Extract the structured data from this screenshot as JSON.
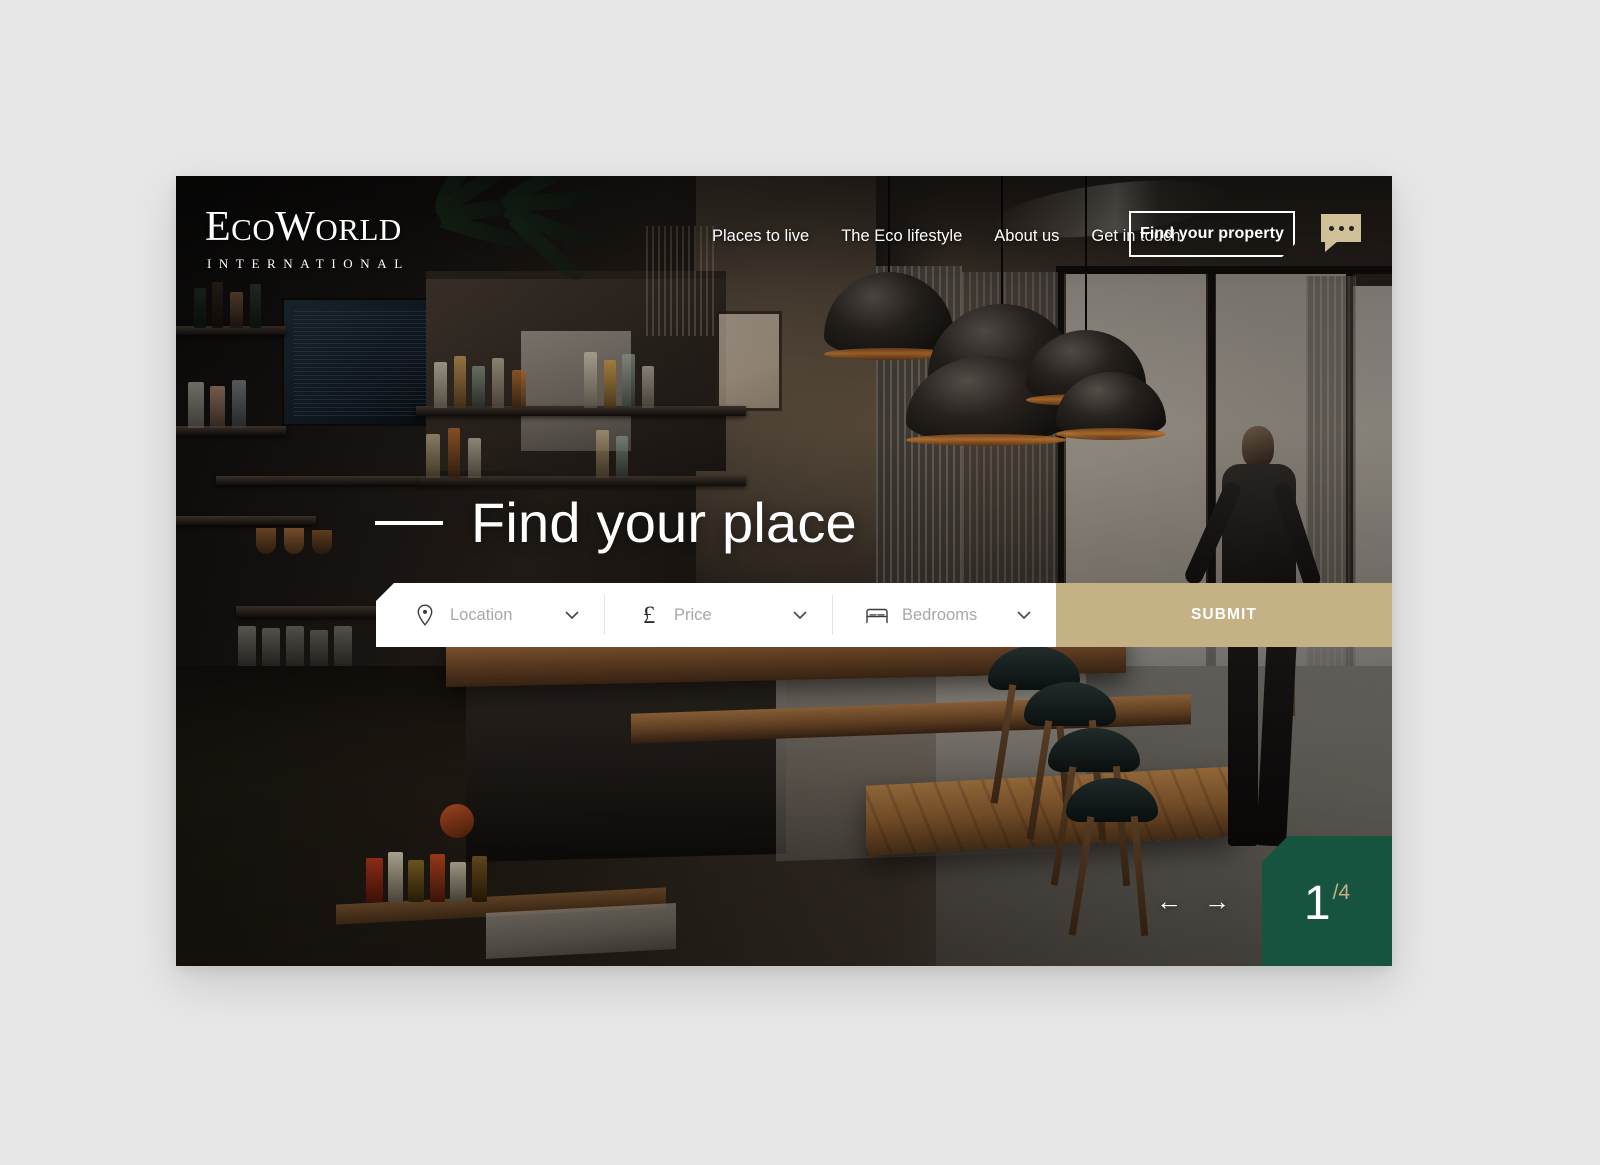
{
  "brand": {
    "logo_part1": "E",
    "logo_part2": "CO",
    "logo_part3": "W",
    "logo_part4": "ORLD",
    "logo_sub": "INTERNATIONAL"
  },
  "nav": {
    "links": [
      {
        "label": "Places to live",
        "name": "nav-places-to-live"
      },
      {
        "label": "The Eco lifestyle",
        "name": "nav-the-eco-lifestyle"
      },
      {
        "label": "About us",
        "name": "nav-about-us"
      },
      {
        "label": "Get in touch",
        "name": "nav-get-in-touch"
      }
    ],
    "cta_label": "Find your property",
    "chat_icon": "chat-bubble-icon"
  },
  "hero": {
    "headline": "Find your place"
  },
  "search": {
    "location": {
      "placeholder": "Location",
      "value": "",
      "icon": "location-pin-icon"
    },
    "price": {
      "placeholder": "Price",
      "value": "",
      "icon": "pound-sterling-icon",
      "symbol": "£"
    },
    "bedrooms": {
      "placeholder": "Bedrooms",
      "value": "",
      "icon": "bed-icon"
    },
    "submit_label": "SUBMIT",
    "chevron_icon": "chevron-down-icon"
  },
  "slider": {
    "prev_icon": "←",
    "next_icon": "→",
    "current": "1",
    "total": "/4"
  },
  "colors": {
    "accent_tan": "#c4b184",
    "badge_green": "#17543f",
    "page_bg": "#e7e7e7",
    "white": "#ffffff"
  }
}
